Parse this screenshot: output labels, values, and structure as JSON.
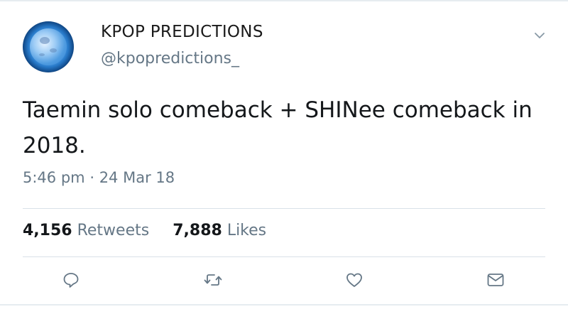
{
  "tweet": {
    "display_name": "KPOP PREDICTIONS",
    "handle": "@kpopredictions_",
    "text": "Taemin solo comeback + SHINee comeback in 2018.",
    "time": "5:46 pm",
    "separator": "·",
    "date": "24 Mar 18",
    "retweets_count": "4,156",
    "retweets_label": "Retweets",
    "likes_count": "7,888",
    "likes_label": "Likes"
  },
  "icons": {
    "menu": "chevron-down-icon",
    "reply": "reply-icon",
    "retweet": "retweet-icon",
    "like": "heart-icon",
    "dm": "envelope-icon"
  },
  "colors": {
    "text_primary": "#14171a",
    "text_secondary": "#657786",
    "icon": "#657786",
    "divider": "#d9e1e8"
  }
}
